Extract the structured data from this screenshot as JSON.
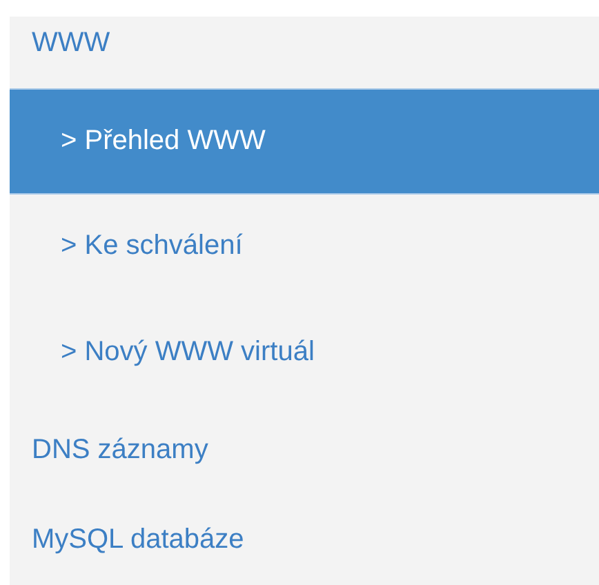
{
  "menu": [
    {
      "label": "WWW",
      "selected": false,
      "children": [
        {
          "label": "> Přehled WWW",
          "selected": true
        },
        {
          "label": "> Ke schválení",
          "selected": false
        },
        {
          "label": "> Nový WWW virtuál",
          "selected": false
        }
      ]
    },
    {
      "label": "DNS záznamy",
      "selected": false
    },
    {
      "label": "MySQL databáze",
      "selected": false
    }
  ]
}
